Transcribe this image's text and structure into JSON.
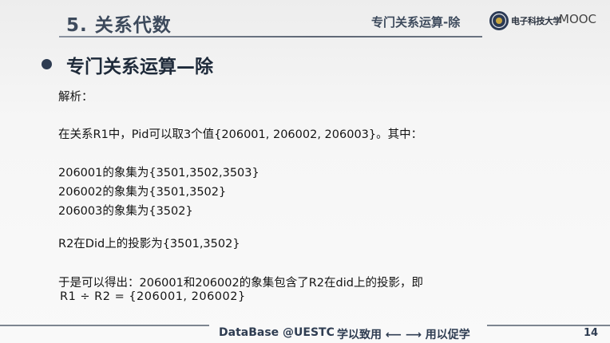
{
  "header": {
    "section_title": "5. 关系代数",
    "subtitle": "专门关系运算-除",
    "logo_text": "电子科技大学",
    "logo_suffix": "MOOC"
  },
  "heading": "专门关系运算—除",
  "content": {
    "line1": "解析：",
    "line2": "在关系R1中，Pid可以取3个值{206001, 206002, 206003}。其中：",
    "line3": "206001的象集为{3501,3502,3503}",
    "line4": "206002的象集为{3501,3502}",
    "line5": "206003的象集为{3502}",
    "line6": "R2在Did上的投影为{3501,3502}",
    "line7": "于是可以得出：206001和206002的象集包含了R2在did上的投影，即",
    "line8": "R1 ÷ R2 = {206001, 206002}"
  },
  "footer": {
    "course": "DataBase @UESTC",
    "motto_left": "学以致用",
    "arrows": "⟵ ⟶",
    "motto_right": "用以促学",
    "page_number": "14"
  }
}
